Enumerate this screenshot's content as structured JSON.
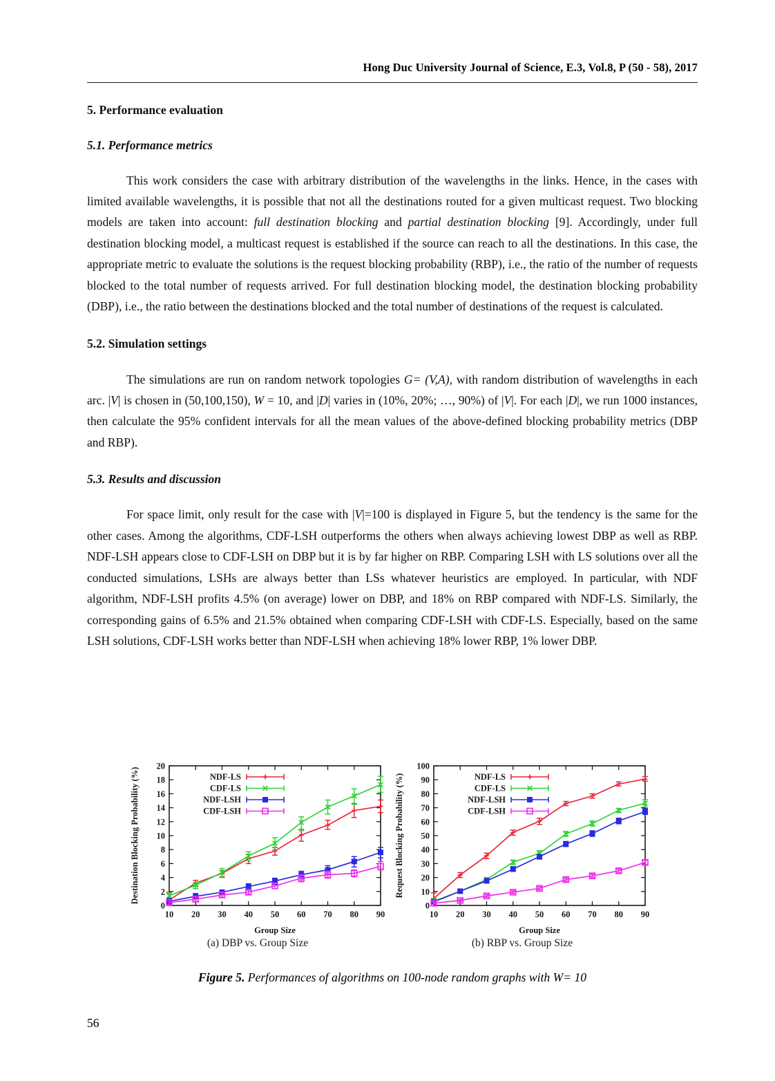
{
  "header": {
    "running_head": "Hong Duc University Journal of Science, E.3, Vol.8, P (50 - 58), 2017"
  },
  "sections": {
    "s5_title": "5. Performance evaluation",
    "s51_title": "5.1. Performance metrics",
    "s51_p1_a": "This work considers the case with arbitrary distribution of the wavelengths in the links. Hence, in the cases with limited available wavelengths, it is possible that not all the destinations routed for a given multicast request. Two blocking models are taken into account: ",
    "s51_p1_i1": "full destination blocking",
    "s51_p1_b": " and ",
    "s51_p1_i2": "partial destination blocking",
    "s51_p1_c": " [9]. Accordingly, under full destination blocking model, a multicast request is established if the source can reach to all the destinations. In this case, the appropriate metric to evaluate the solutions is the request blocking probability (RBP), i.e., the ratio of the number of requests blocked to the total number of requests arrived. For full destination blocking model, the destination blocking probability (DBP), i.e., the ratio between the destinations blocked and the total number of destinations of the request is calculated.",
    "s52_title": "5.2. Simulation settings",
    "s52_p1_a": "The simulations are run on random network topologies ",
    "s52_p1_i1": "G=",
    "s52_p1_b": " ",
    "s52_p1_i2": "(V,A)",
    "s52_p1_c": ", with random distribution of wavelengths in each arc. |",
    "s52_p1_i3": "V",
    "s52_p1_d": "| is chosen in (50,100,150), ",
    "s52_p1_i4": "W",
    "s52_p1_e": " = 10, and |",
    "s52_p1_i5": "D",
    "s52_p1_f": "| varies in (10%, 20%; …, 90%) of |",
    "s52_p1_i6": "V",
    "s52_p1_g": "|. For each |",
    "s52_p1_i7": "D",
    "s52_p1_h": "|, we run 1000 instances, then calculate the 95% confident intervals for all the mean values of the above-defined blocking probability metrics (DBP and RBP).",
    "s53_title": "5.3. Results and discussion",
    "s53_p1_a": "For space limit, only result for the case with |",
    "s53_p1_i1": "V",
    "s53_p1_b": "|=100 is displayed in Figure 5, but the tendency is the same for the other cases. Among the algorithms, CDF-LSH outperforms the others when always achieving lowest DBP as well as RBP. NDF-LSH appears close to CDF-LSH on DBP but it is by far higher on RBP. Comparing LSH with LS solutions over all the conducted simulations, LSHs are always better than LSs whatever heuristics are employed. In particular, with NDF algorithm, NDF-LSH profits 4.5% (on average) lower on DBP, and 18% on RBP compared with NDF-LS. Similarly, the corresponding gains of 6.5% and 21.5% obtained when comparing CDF-LSH with CDF-LS. Especially, based on the same LSH solutions, CDF-LSH works better than NDF-LSH when achieving 18% lower RBP, 1% lower DBP."
  },
  "figure": {
    "subcaption_a": "(a) DBP vs. Group Size",
    "subcaption_b": "(b) RBP vs. Group Size",
    "caption_label": "Figure 5.",
    "caption_text": " Performances of algorithms on 100-node random graphs with W= 10"
  },
  "page_number": "56",
  "colors": {
    "ndf_ls": "#e8273a",
    "cdf_ls": "#2fd23b",
    "ndf_lsh": "#2a2ae0",
    "cdf_lsh": "#ee2fee",
    "axis": "#1a1a1a"
  },
  "chart_data": [
    {
      "type": "line",
      "id": "dbp",
      "title": "(a) DBP vs. Group Size",
      "xlabel": "Group Size",
      "ylabel": "Destination Blocking Probability (%)",
      "x": [
        10,
        20,
        30,
        40,
        50,
        60,
        70,
        80,
        90
      ],
      "xlim": [
        10,
        90
      ],
      "ylim": [
        0,
        20
      ],
      "xticks": [
        10,
        20,
        30,
        40,
        50,
        60,
        70,
        80,
        90
      ],
      "yticks": [
        0,
        2,
        4,
        6,
        8,
        10,
        12,
        14,
        16,
        18,
        20
      ],
      "grid": false,
      "legend_position": "top-left",
      "error_bars": "95% confidence intervals",
      "series": [
        {
          "name": "NDF-LS",
          "color": "#e8273a",
          "marker": "plus",
          "values": [
            0.8,
            3.2,
            4.6,
            6.7,
            7.8,
            10.1,
            11.5,
            13.6,
            14.2
          ],
          "err_low": [
            0.3,
            2.8,
            4.1,
            6.0,
            7.2,
            9.2,
            10.9,
            12.6,
            13.3
          ],
          "err_high": [
            1.9,
            3.6,
            5.0,
            7.3,
            8.3,
            10.9,
            12.2,
            14.6,
            15.1
          ]
        },
        {
          "name": "CDF-LS",
          "color": "#2fd23b",
          "marker": "cross",
          "values": [
            1.4,
            2.9,
            4.7,
            7.1,
            8.9,
            11.9,
            14.1,
            15.7,
            17.3
          ],
          "err_low": [
            1.0,
            2.4,
            4.0,
            6.4,
            8.0,
            10.7,
            13.1,
            14.5,
            16.2
          ],
          "err_high": [
            1.8,
            3.3,
            5.3,
            7.7,
            9.7,
            12.7,
            15.1,
            16.7,
            18.5
          ]
        },
        {
          "name": "NDF-LSH",
          "color": "#2a2ae0",
          "marker": "filled-square",
          "values": [
            0.6,
            1.3,
            1.9,
            2.7,
            3.5,
            4.4,
            5.1,
            6.3,
            7.6
          ],
          "err_low": [
            0.2,
            0.9,
            1.5,
            2.2,
            3.0,
            3.8,
            4.5,
            5.5,
            6.8
          ],
          "err_high": [
            1.0,
            1.7,
            2.2,
            3.1,
            3.9,
            4.9,
            5.7,
            7.0,
            8.3
          ]
        },
        {
          "name": "CDF-LSH",
          "color": "#ee2fee",
          "marker": "open-square",
          "values": [
            0.4,
            0.9,
            1.5,
            1.9,
            2.8,
            3.9,
            4.4,
            4.6,
            5.6
          ],
          "err_low": [
            0.1,
            0.6,
            1.2,
            1.6,
            2.4,
            3.4,
            3.9,
            4.1,
            5.1
          ],
          "err_high": [
            0.8,
            1.3,
            1.9,
            2.3,
            3.2,
            4.4,
            4.9,
            5.1,
            6.3
          ]
        }
      ]
    },
    {
      "type": "line",
      "id": "rbp",
      "title": "(b) RBP vs. Group Size",
      "xlabel": "Group Size",
      "ylabel": "Request Blocking Probability (%)",
      "x": [
        10,
        20,
        30,
        40,
        50,
        60,
        70,
        80,
        90
      ],
      "xlim": [
        10,
        90
      ],
      "ylim": [
        0,
        100
      ],
      "xticks": [
        10,
        20,
        30,
        40,
        50,
        60,
        70,
        80,
        90
      ],
      "yticks": [
        0,
        10,
        20,
        30,
        40,
        50,
        60,
        70,
        80,
        90,
        100
      ],
      "grid": false,
      "legend_position": "top-left",
      "error_bars": "95% confidence intervals",
      "series": [
        {
          "name": "NDF-LS",
          "color": "#e8273a",
          "marker": "plus",
          "values": [
            5.0,
            21.8,
            35.6,
            52.3,
            60.3,
            73.0,
            78.4,
            87.0,
            90.5
          ],
          "err_low": [
            2.0,
            20.0,
            33.5,
            50.3,
            58.0,
            71.5,
            76.8,
            85.5,
            89.0
          ],
          "err_high": [
            9.0,
            23.5,
            37.5,
            54.0,
            62.5,
            74.5,
            80.0,
            88.5,
            92.3
          ]
        },
        {
          "name": "CDF-LS",
          "color": "#2fd23b",
          "marker": "cross",
          "values": [
            3.0,
            10.2,
            18.6,
            31.0,
            37.3,
            51.2,
            58.6,
            68.2,
            73.2
          ],
          "err_low": [
            1.5,
            9.0,
            17.2,
            29.3,
            35.5,
            49.5,
            56.8,
            66.5,
            70.5
          ],
          "err_high": [
            5.0,
            11.5,
            20.0,
            32.5,
            39.2,
            53.0,
            60.5,
            69.5,
            75.8
          ]
        },
        {
          "name": "NDF-LSH",
          "color": "#2a2ae0",
          "marker": "filled-square",
          "values": [
            2.5,
            10.2,
            17.6,
            26.0,
            35.0,
            44.0,
            51.5,
            60.6,
            67.2
          ],
          "err_low": [
            1.2,
            9.2,
            16.2,
            24.5,
            33.2,
            42.2,
            49.5,
            58.5,
            65.2
          ],
          "err_high": [
            4.2,
            11.3,
            19.2,
            27.8,
            36.5,
            45.8,
            53.5,
            62.5,
            69.5
          ]
        },
        {
          "name": "CDF-LSH",
          "color": "#ee2fee",
          "marker": "open-square",
          "values": [
            1.6,
            3.6,
            6.8,
            9.5,
            12.2,
            18.5,
            21.2,
            24.8,
            30.8
          ],
          "err_low": [
            0.8,
            2.8,
            5.8,
            8.5,
            11.2,
            17.3,
            20.0,
            23.5,
            29.3
          ],
          "err_high": [
            2.5,
            4.5,
            7.8,
            10.5,
            13.3,
            19.6,
            22.4,
            26.0,
            32.3
          ]
        }
      ]
    }
  ]
}
